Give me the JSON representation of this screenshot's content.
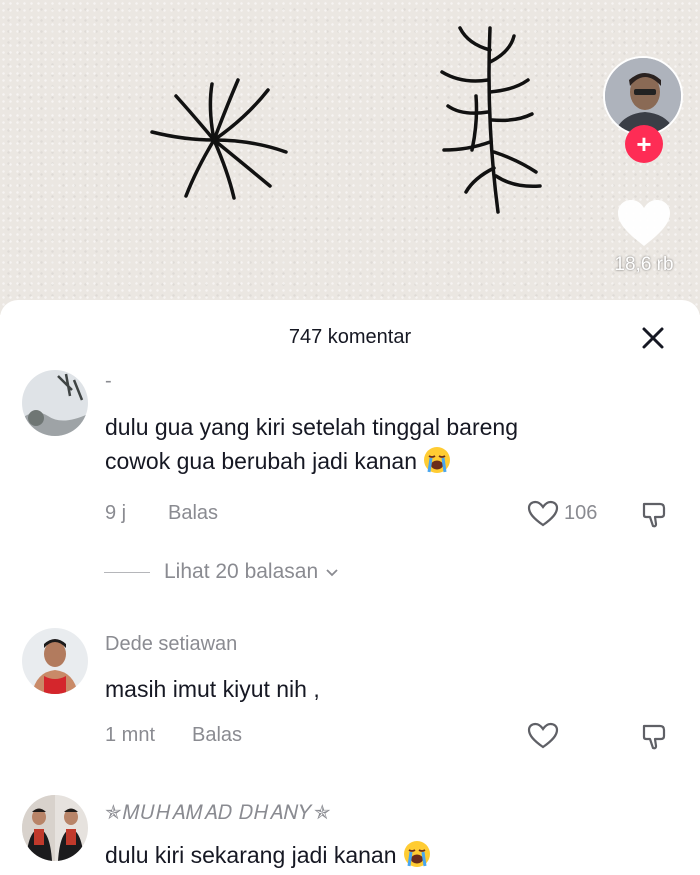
{
  "video": {
    "like_count": "18,6 rb"
  },
  "comments_sheet": {
    "title": "747 komentar"
  },
  "comments": [
    {
      "username": "-",
      "text_line1": "dulu gua yang kiri setelah tinggal bareng",
      "text_line2": "cowok gua berubah jadi kanan",
      "emoji": "loudly-crying-face",
      "time": "9 j",
      "reply_label": "Balas",
      "likes": "106",
      "view_replies": "Lihat 20 balasan"
    },
    {
      "username": "Dede setiawan",
      "text": "masih imut kiyut nih ,",
      "time": "1 mnt",
      "reply_label": "Balas"
    },
    {
      "username": "✯𝑀𝑈𝐻𝐴𝑀𝐴𝐷 𝐷𝐻𝐴𝑁𝑌✯",
      "text": "dulu kiri sekarang jadi kanan",
      "emoji": "loudly-crying-face"
    }
  ],
  "colors": {
    "accent": "#fe2c55",
    "secondary_text": "#8a8b91",
    "primary_text": "#161823"
  }
}
